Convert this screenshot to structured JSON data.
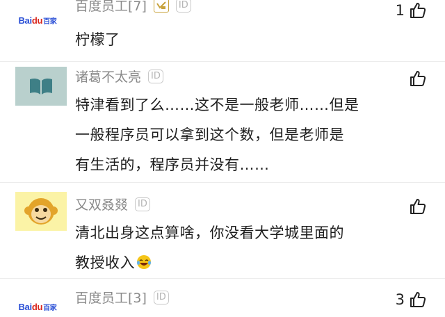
{
  "comments": [
    {
      "avatar": "baidu-logo",
      "avatar_text": "Bai",
      "avatar_text_red": "du",
      "avatar_text_cn": "百家",
      "name": "百度员工[7]",
      "badges": [
        "level-badge",
        "id-badge"
      ],
      "id_label": "ID",
      "lines": [
        "柠檬了"
      ],
      "like_count": "1"
    },
    {
      "avatar": "book-avatar",
      "name": "诸葛不太亮",
      "id_label": "ID",
      "lines": [
        "特津看到了么……这不是一般老师……但是",
        "一般程序员可以拿到这个数，但是老师是",
        "有生活的，程序员并没有……"
      ],
      "like_count": ""
    },
    {
      "avatar": "monkey-avatar",
      "name": "又双叒叕",
      "id_label": "ID",
      "lines": [
        "清北出身这点算啥，你没看大学城里面的",
        "教授收入"
      ],
      "emoji": "laughing-tears-emoji",
      "like_count": ""
    },
    {
      "avatar": "baidu-logo",
      "avatar_text": "Bai",
      "avatar_text_red": "du",
      "avatar_text_cn": "百家",
      "name": "百度员工[3]",
      "id_label": "ID",
      "lines": [],
      "like_count": "3"
    }
  ],
  "colors": {
    "name": "#8a8a8a",
    "text": "#1e1e1e",
    "book_bg": "#b9d0cd",
    "book_icon": "#3e7f86",
    "monkey": "#e3a42a",
    "monkey_bg": "#fbf3a6"
  }
}
